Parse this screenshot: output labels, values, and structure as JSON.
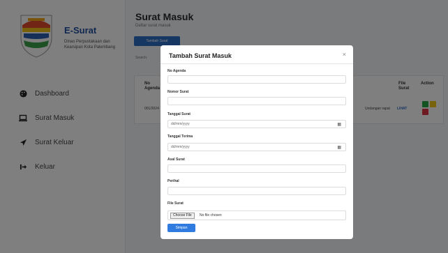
{
  "app": {
    "brand": "E-Surat",
    "org": "Dinas Perpustakaan dan Kearsipan Kota Palembang"
  },
  "sidebar": {
    "items": [
      {
        "label": "Dashboard",
        "icon": "palette-icon"
      },
      {
        "label": "Surat Masuk",
        "icon": "laptop-icon"
      },
      {
        "label": "Surat Keluar",
        "icon": "send-icon"
      },
      {
        "label": "Keluar",
        "icon": "logout-icon"
      }
    ]
  },
  "main": {
    "title": "Surat Masuk",
    "subtitle": "Daftar surat masuk",
    "add_button": "Tambah Surat",
    "search_label": "Search:",
    "table": {
      "headers": [
        "No Agenda",
        "File Surat",
        "Action"
      ],
      "row": {
        "first": "001/2024",
        "mid": "Undangan rapat",
        "file": "LIHAT"
      }
    }
  },
  "modal": {
    "title": "Tambah Surat Masuk",
    "close": "×",
    "fields": {
      "no_agenda": {
        "label": "No Agenda",
        "value": ""
      },
      "nomor_surat": {
        "label": "Nomor Surat",
        "value": ""
      },
      "tanggal_surat": {
        "label": "Tanggal Surat",
        "placeholder": "dd/mm/yyyy"
      },
      "tanggal_terima": {
        "label": "Tanggal Terima",
        "placeholder": "dd/mm/yyyy"
      },
      "asal_surat": {
        "label": "Asal Surat",
        "value": ""
      },
      "perihal": {
        "label": "Perihal",
        "value": ""
      },
      "file_surat": {
        "label": "File Surat",
        "button": "Choose File",
        "status": "No file chosen"
      }
    },
    "submit": "Simpan"
  },
  "colors": {
    "primary": "#2f6ec7",
    "brand": "#1e4fa0",
    "action_green": "#28a745",
    "action_yellow": "#f0c419",
    "action_red": "#dc3545"
  }
}
